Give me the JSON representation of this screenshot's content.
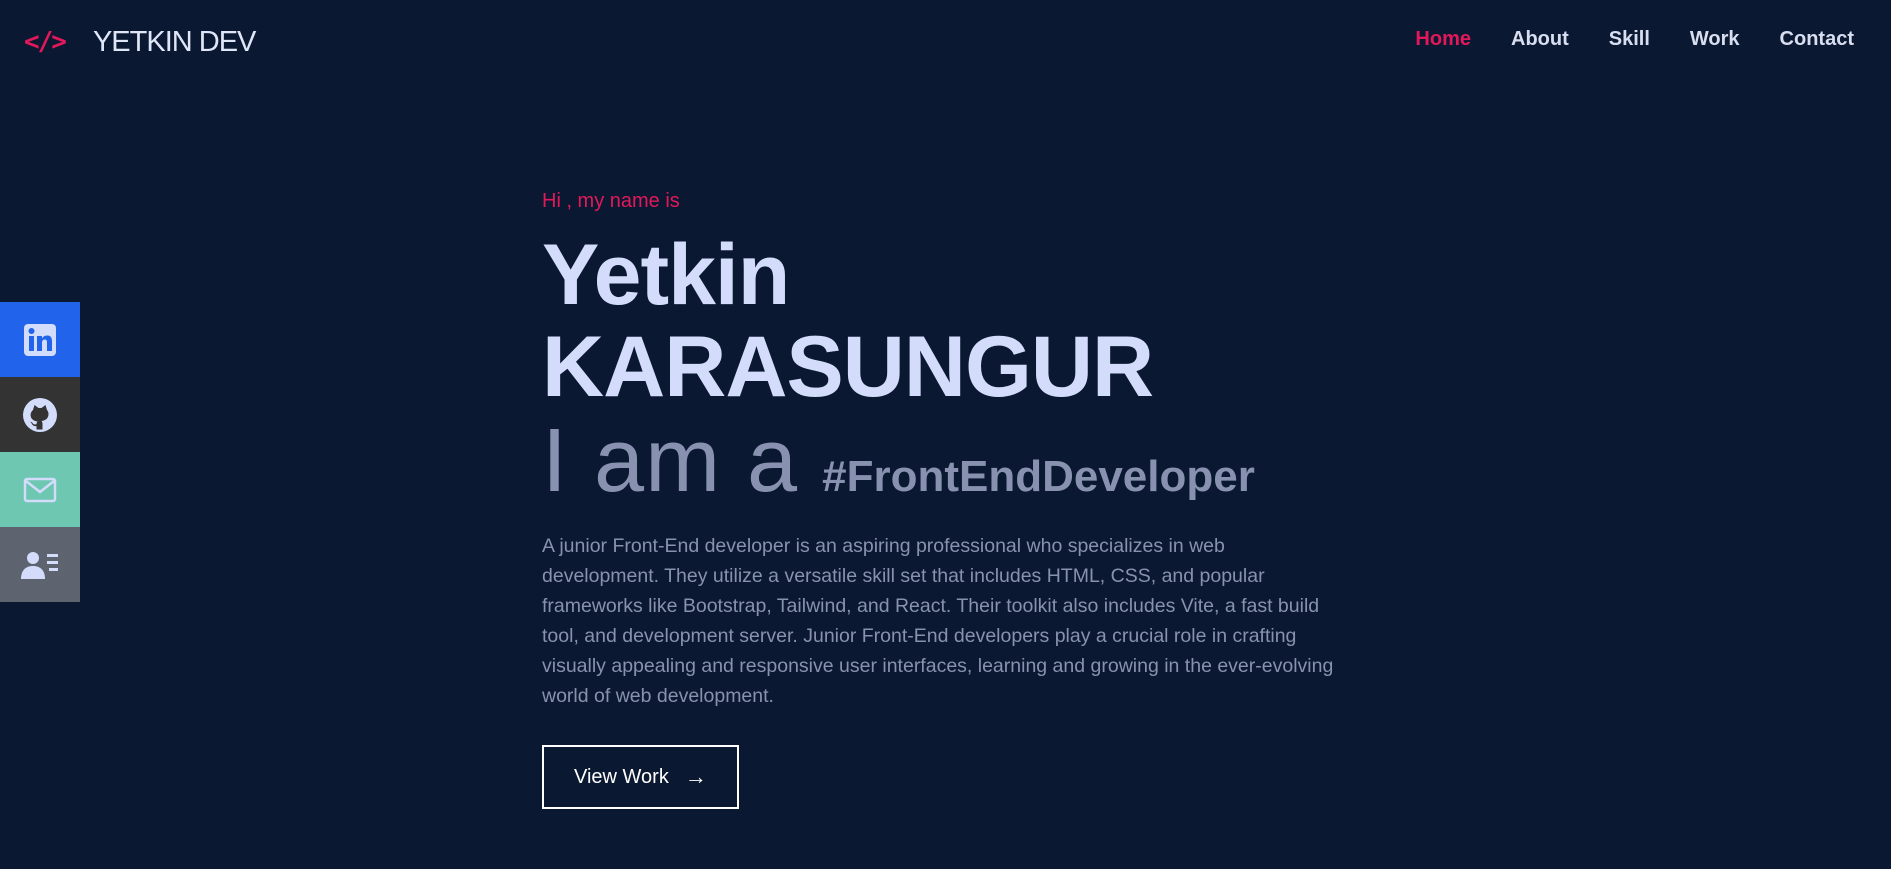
{
  "header": {
    "logo_icon": "</>",
    "logo_text": "YETKIN DEV",
    "nav": [
      {
        "label": "Home",
        "active": true
      },
      {
        "label": "About",
        "active": false
      },
      {
        "label": "Skill",
        "active": false
      },
      {
        "label": "Work",
        "active": false
      },
      {
        "label": "Contact",
        "active": false
      }
    ]
  },
  "social": [
    {
      "icon": "linkedin-icon",
      "color": "#2163eb"
    },
    {
      "icon": "github-icon",
      "color": "#333333"
    },
    {
      "icon": "email-icon",
      "color": "#6dc7b1"
    },
    {
      "icon": "contact-card-icon",
      "color": "#5d636f"
    }
  ],
  "hero": {
    "greeting": "Hi , my name is",
    "first_name": "Yetkin",
    "last_name": "KARASUNGUR",
    "role_prefix": "I am a",
    "role_tag": "#FrontEndDeveloper",
    "description": "A junior Front-End developer is an aspiring professional who specializes in web development. They utilize a versatile skill set that includes HTML, CSS, and popular frameworks like Bootstrap, Tailwind, and React. Their toolkit also includes Vite, a fast build tool, and development server. Junior Front-End developers play a crucial role in crafting visually appealing and responsive user interfaces, learning and growing in the ever-evolving world of web development.",
    "button_label": "View Work",
    "button_arrow": "→"
  },
  "colors": {
    "background": "#0b1831",
    "accent": "#e2185b",
    "heading": "#d3ddfb",
    "muted": "#8892b0"
  }
}
